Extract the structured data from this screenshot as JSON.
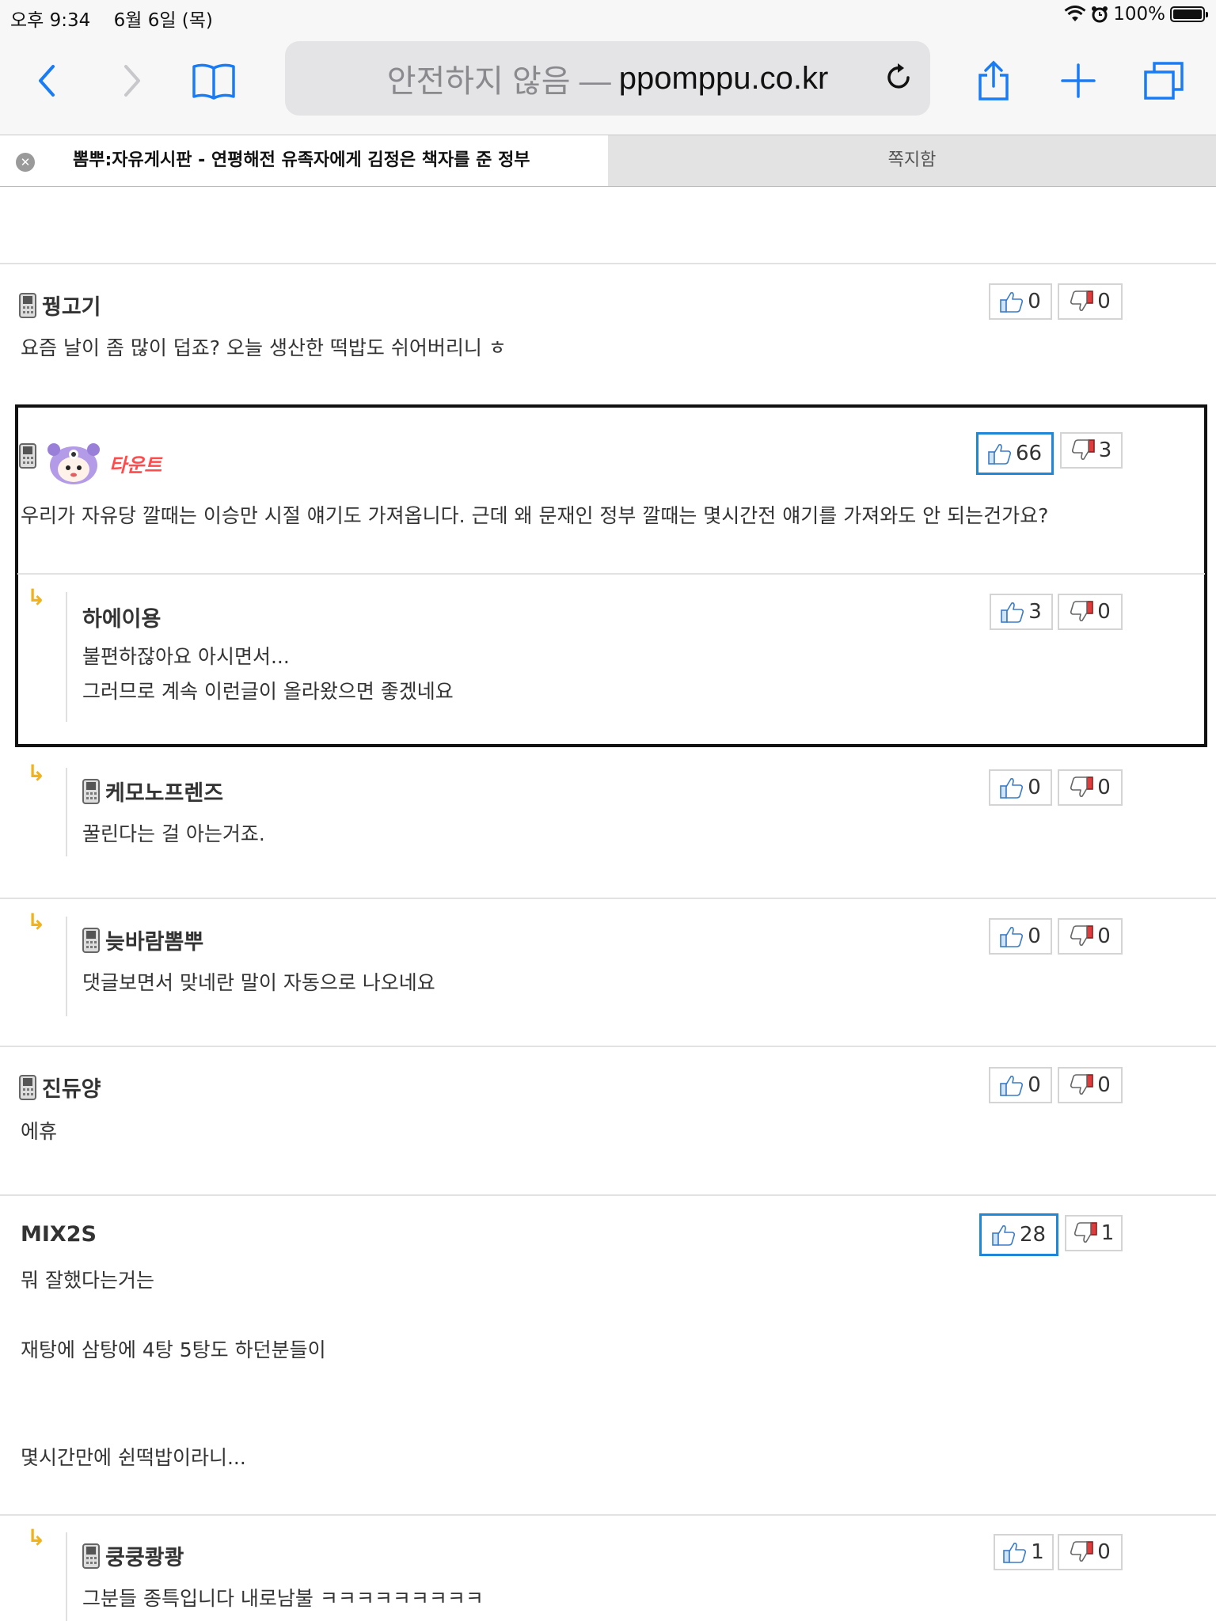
{
  "status_bar": {
    "time": "오후 9:34",
    "date": "6월 6일 (목)",
    "battery": "100%"
  },
  "browser": {
    "url_insecure": "안전하지 않음 —",
    "url_domain": "ppomppu.co.kr",
    "tabs": [
      {
        "title": "뽐뿌:자유게시판 - 연평해전 유족자에게 김정은 책자를 준 정부",
        "active": true
      },
      {
        "title": "쪽지함",
        "active": false
      }
    ]
  },
  "comments": [
    {
      "author": "꿩고기",
      "lines": [
        "요즘 날이 좀 많이 덥죠? 오늘 생산한 떡밥도 쉬어버리니 ㅎ"
      ],
      "up": "0",
      "down": "0"
    },
    {
      "author": "타운트",
      "lines": [
        "우리가 자유당 깔때는 이승만 시절 얘기도 가져옵니다. 근데 왜 문재인 정부 깔때는 몇시간전 얘기를 가져와도 안 되는건가요?"
      ],
      "up": "66",
      "down": "3"
    },
    {
      "author": "하에이용",
      "lines": [
        "불편하잖아요 아시면서...",
        "그러므로 계속 이런글이 올라왔으면 좋겠네요"
      ],
      "up": "3",
      "down": "0"
    },
    {
      "author": "케모노프렌즈",
      "lines": [
        "꿀린다는 걸 아는거죠."
      ],
      "up": "0",
      "down": "0"
    },
    {
      "author": "늦바람뽐뿌",
      "lines": [
        "댓글보면서 맞네란 말이 자동으로 나오네요"
      ],
      "up": "0",
      "down": "0"
    },
    {
      "author": "진듀양",
      "lines": [
        "에휴"
      ],
      "up": "0",
      "down": "0"
    },
    {
      "author": "MIX2S",
      "lines": [
        "뭐 잘했다는거는",
        "재탕에 삼탕에 4탕 5탕도 하던분들이",
        "몇시간만에 쉰떡밥이라니..."
      ],
      "up": "28",
      "down": "1"
    },
    {
      "author": "쿵쿵쾅쾅",
      "lines": [
        "그분들 종특입니다 내로남불 ㅋㅋㅋㅋㅋㅋㅋㅋㅋ"
      ],
      "up": "1",
      "down": "0"
    }
  ],
  "colors": {
    "highlight_vote": "#1f86d8",
    "reply_arrow": "#f1b21b",
    "url_bar": "#e4e4e6",
    "ios_blue": "#1a7cf5"
  }
}
